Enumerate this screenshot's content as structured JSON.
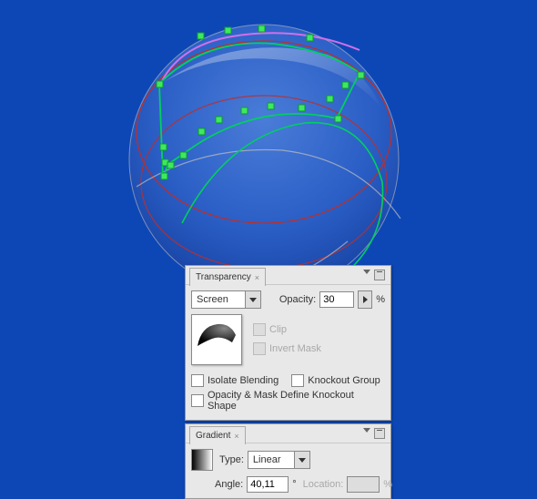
{
  "transparency": {
    "tab_label": "Transparency",
    "blend_mode": "Screen",
    "opacity_label": "Opacity:",
    "opacity_value": "30",
    "pct": "%",
    "clip_label": "Clip",
    "invert_label": "Invert Mask",
    "isolate_label": "Isolate Blending",
    "knockout_label": "Knockout Group",
    "opacity_mask_label": "Opacity & Mask Define Knockout Shape"
  },
  "gradient": {
    "tab_label": "Gradient",
    "type_label": "Type:",
    "type_value": "Linear",
    "angle_label": "Angle:",
    "angle_value": "40,11",
    "deg": "°",
    "location_label": "Location:",
    "location_value": "",
    "pct": "%"
  }
}
